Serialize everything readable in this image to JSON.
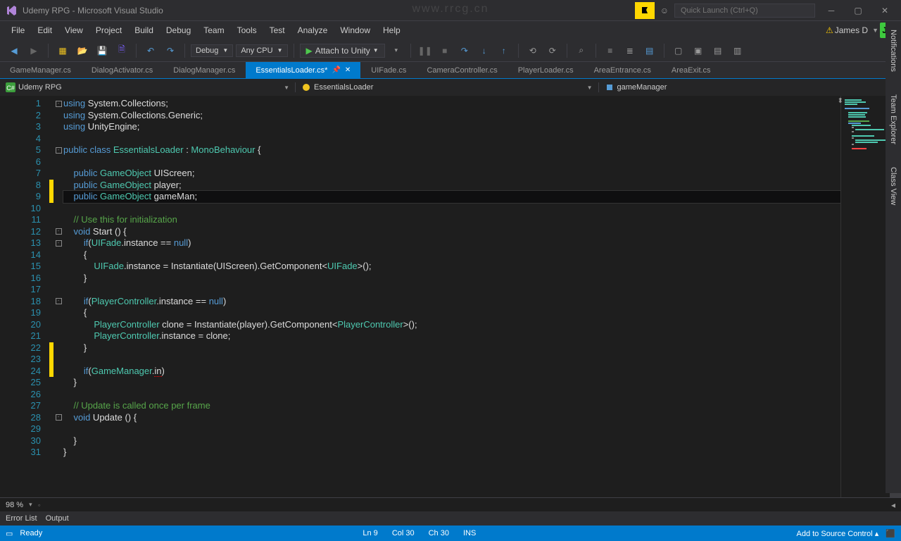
{
  "watermark": "www.rrcg.cn",
  "title": "Udemy RPG - Microsoft Visual Studio",
  "quick_launch_placeholder": "Quick Launch (Ctrl+Q)",
  "menu": [
    "File",
    "Edit",
    "View",
    "Project",
    "Build",
    "Debug",
    "Team",
    "Tools",
    "Test",
    "Analyze",
    "Window",
    "Help"
  ],
  "user_name": "James D",
  "user_initials": "JD",
  "toolbar": {
    "config": "Debug",
    "platform": "Any CPU",
    "attach": "Attach to Unity"
  },
  "tabs": [
    "GameManager.cs",
    "DialogActivator.cs",
    "DialogManager.cs",
    "EssentialsLoader.cs*",
    "UIFade.cs",
    "CameraController.cs",
    "PlayerLoader.cs",
    "AreaEntrance.cs",
    "AreaExit.cs"
  ],
  "active_tab_index": 3,
  "nav": {
    "project": "Udemy RPG",
    "class": "EssentialsLoader",
    "member": "gameManager"
  },
  "right_tabs": [
    "Notifications",
    "Team Explorer",
    "Class View"
  ],
  "zoom": "98 %",
  "bottom_tabs": [
    "Error List",
    "Output"
  ],
  "status": {
    "ready": "Ready",
    "line": "Ln 9",
    "col": "Col 30",
    "ch": "Ch 30",
    "ins": "INS",
    "scc": "Add to Source Control"
  },
  "line_numbers": [
    1,
    2,
    3,
    4,
    5,
    6,
    7,
    8,
    9,
    10,
    11,
    12,
    13,
    14,
    15,
    16,
    17,
    18,
    19,
    20,
    21,
    22,
    23,
    24,
    25,
    26,
    27,
    28,
    29,
    30,
    31
  ],
  "code_lines": [
    {
      "fold": "-",
      "html": "<span class='kw'>using</span> System.Collections;"
    },
    {
      "html": "<span class='kw'>using</span> System.Collections.Generic;"
    },
    {
      "html": "<span class='kw'>using</span> UnityEngine;"
    },
    {
      "html": ""
    },
    {
      "fold": "-",
      "html": "<span class='kw'>public</span> <span class='kw'>class</span> <span class='type'>EssentialsLoader</span> : <span class='type'>MonoBehaviour</span> {"
    },
    {
      "html": ""
    },
    {
      "html": "    <span class='kw'>public</span> <span class='type'>GameObject</span> UIScreen;"
    },
    {
      "mark": "yellow",
      "html": "    <span class='kw'>public</span> <span class='type'>GameObject</span> player;"
    },
    {
      "mark": "yellow",
      "current": true,
      "html": "    <span class='kw'>public</span> <span class='type'>GameObject</span> gameMan;"
    },
    {
      "html": ""
    },
    {
      "html": "    <span class='com'>// Use this for initialization</span>"
    },
    {
      "fold": "-",
      "html": "    <span class='kw'>void</span> Start () {"
    },
    {
      "fold": "-",
      "html": "        <span class='kw'>if</span>(<span class='type'>UIFade</span>.instance == <span class='kw'>null</span>)"
    },
    {
      "html": "        {"
    },
    {
      "html": "            <span class='type'>UIFade</span>.instance = Instantiate(UIScreen).GetComponent&lt;<span class='type'>UIFade</span>&gt;();"
    },
    {
      "html": "        }"
    },
    {
      "html": ""
    },
    {
      "fold": "-",
      "html": "        <span class='kw'>if</span>(<span class='type'>PlayerController</span>.instance == <span class='kw'>null</span>)"
    },
    {
      "html": "        {"
    },
    {
      "html": "            <span class='type'>PlayerController</span> clone = Instantiate(player).GetComponent&lt;<span class='type'>PlayerController</span>&gt;();"
    },
    {
      "html": "            <span class='type'>PlayerController</span>.instance = clone;"
    },
    {
      "mark": "yellow",
      "html": "        }"
    },
    {
      "mark": "yellow",
      "html": ""
    },
    {
      "mark": "yellow",
      "html": "        <span class='kw'>if</span>(<span class='type'>GameManager</span>.<span style='color:#dcdcdc;border-bottom:1px dotted #f00'>in</span>)"
    },
    {
      "html": "    }"
    },
    {
      "html": ""
    },
    {
      "html": "    <span class='com'>// Update is called once per frame</span>"
    },
    {
      "fold": "-",
      "html": "    <span class='kw'>void</span> Update () {"
    },
    {
      "html": "        "
    },
    {
      "html": "    }"
    },
    {
      "html": "}"
    }
  ]
}
